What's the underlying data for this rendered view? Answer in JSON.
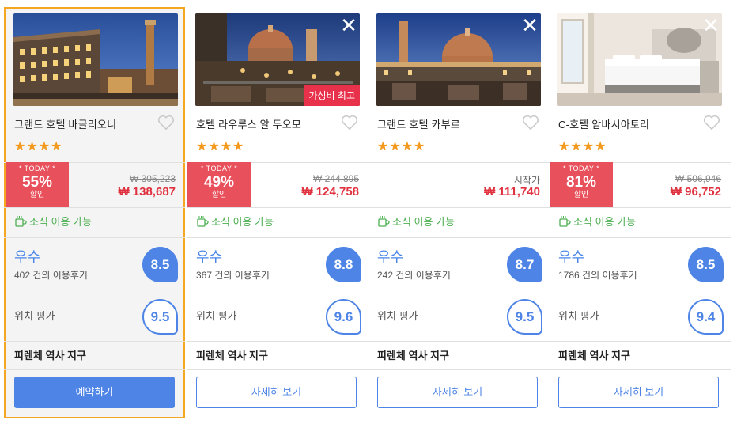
{
  "cards": [
    {
      "name": "그랜드 호텔 바글리오니",
      "stars": "★★★★",
      "deal_tag": "* TODAY *",
      "deal_percent": "55%",
      "deal_off": "할인",
      "original_price": "₩ 305,223",
      "price": "₩ 138,687",
      "breakfast": "조식 이용 가능",
      "grade": "우수",
      "reviews": "402 건의 이용후기",
      "score": "8.5",
      "location_label": "위치 평가",
      "location_score": "9.5",
      "area": "피렌체 역사 지구",
      "button": "예약하기"
    },
    {
      "name": "호텔 라우루스 알 두오모",
      "stars": "★★★★",
      "close": "✕",
      "badge": "가성비 최고",
      "deal_tag": "* TODAY *",
      "deal_percent": "49%",
      "deal_off": "할인",
      "original_price": "₩ 244,895",
      "price": "₩ 124,758",
      "breakfast": "조식 이용 가능",
      "grade": "우수",
      "reviews": "367 건의 이용후기",
      "score": "8.8",
      "location_label": "위치 평가",
      "location_score": "9.6",
      "area": "피렌체 역사 지구",
      "button": "자세히 보기"
    },
    {
      "name": "그랜드 호텔 카부르",
      "stars": "★★★★",
      "close": "✕",
      "from_label": "시작가",
      "price": "₩ 111,740",
      "breakfast": "조식 이용 가능",
      "grade": "우수",
      "reviews": "242 건의 이용후기",
      "score": "8.7",
      "location_label": "위치 평가",
      "location_score": "9.5",
      "area": "피렌체 역사 지구",
      "button": "자세히 보기"
    },
    {
      "name": "C-호텔 암바시아토리",
      "stars": "★★★★",
      "close": "✕",
      "deal_tag": "* TODAY *",
      "deal_percent": "81%",
      "deal_off": "할인",
      "original_price": "₩ 506,946",
      "price": "₩ 96,752",
      "breakfast": "조식 이용 가능",
      "grade": "우수",
      "reviews": "1786 건의 이용후기",
      "score": "8.5",
      "location_label": "위치 평가",
      "location_score": "9.4",
      "area": "피렌체 역사 지구",
      "button": "자세히 보기"
    }
  ],
  "colors": {
    "accent": "#4d84e6",
    "deal": "#e8505b",
    "price": "#e0313f",
    "stars": "#f39a1e",
    "breakfast": "#4caf50",
    "selected_border": "#f5a623"
  }
}
